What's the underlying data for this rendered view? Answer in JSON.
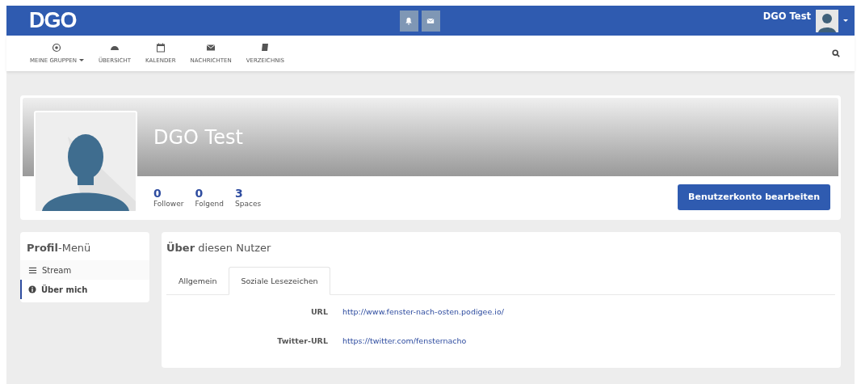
{
  "header": {
    "logo": "DGO",
    "user_name": "DGO Test"
  },
  "nav": {
    "items": [
      {
        "label": "MEINE GRUPPEN",
        "dropdown": true
      },
      {
        "label": "ÜBERSICHT",
        "dropdown": false
      },
      {
        "label": "KALENDER",
        "dropdown": false
      },
      {
        "label": "NACHRICHTEN",
        "dropdown": false
      },
      {
        "label": "VERZEICHNIS",
        "dropdown": false
      }
    ]
  },
  "profile": {
    "name": "DGO Test",
    "stats": [
      {
        "count": "0",
        "label": "Follower"
      },
      {
        "count": "0",
        "label": "Folgend"
      },
      {
        "count": "3",
        "label": "Spaces"
      }
    ],
    "edit_button": "Benutzerkonto bearbeiten"
  },
  "profile_menu": {
    "title": "**Profil**-Menü",
    "items": [
      {
        "label": "Stream",
        "selected": false
      },
      {
        "label": "Über mich",
        "selected": true
      }
    ]
  },
  "about": {
    "title": "**Über** diesen Nutzer",
    "tabs": [
      {
        "label": "Allgemein",
        "selected": false
      },
      {
        "label": "Soziale Lesezeichen",
        "selected": true
      }
    ],
    "fields": [
      {
        "label": "URL",
        "value": "http://www.fenster-nach-osten.podigee.io/"
      },
      {
        "label": "Twitter-URL",
        "value": "https://twitter.com/fensternacho"
      }
    ]
  }
}
